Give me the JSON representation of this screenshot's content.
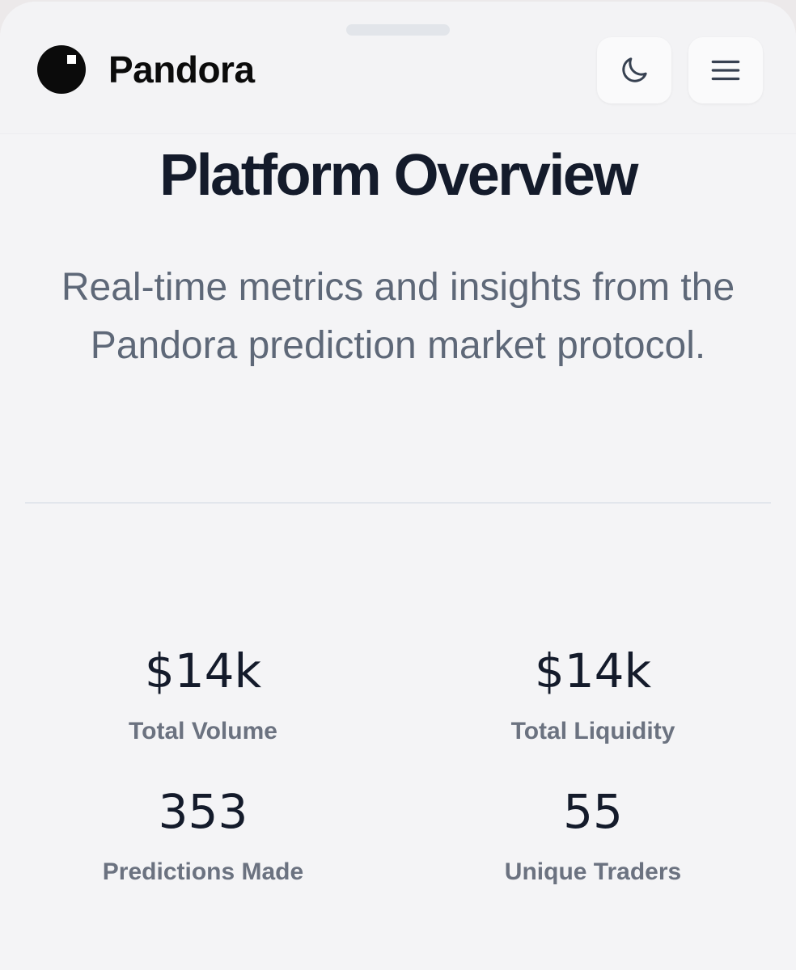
{
  "header": {
    "brand": "Pandora",
    "icons": {
      "logo": "pandora-logo",
      "theme_toggle": "moon-icon",
      "menu": "hamburger-menu-icon"
    }
  },
  "main": {
    "title": "Platform Overview",
    "subtitle": "Real-time metrics and insights from the Pandora prediction market protocol."
  },
  "stats": [
    {
      "value": "$14k",
      "label": "Total Volume"
    },
    {
      "value": "$14k",
      "label": "Total Liquidity"
    },
    {
      "value": "353",
      "label": "Predictions Made"
    },
    {
      "value": "55",
      "label": "Unique Traders"
    }
  ],
  "colors": {
    "background": "#f4f4f6",
    "title": "#141b2b",
    "subtitle": "#5e6878",
    "label": "#6b7280"
  }
}
